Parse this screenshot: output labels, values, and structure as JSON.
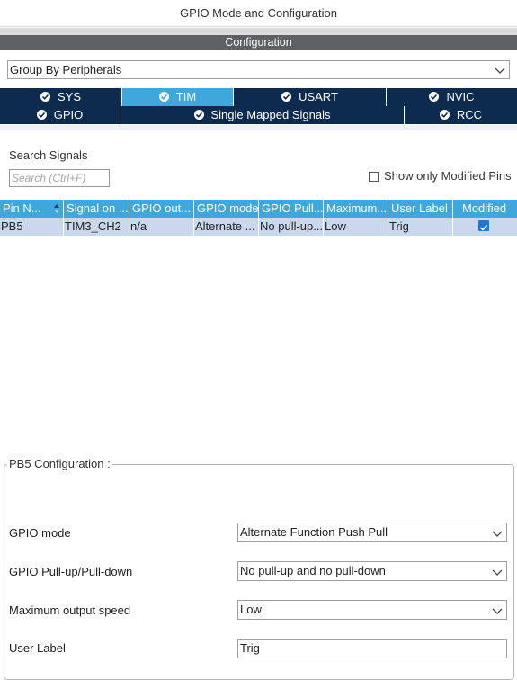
{
  "window": {
    "title": "GPIO Mode and Configuration"
  },
  "configuration_header": "Configuration",
  "group_select": {
    "value": "Group By Peripherals"
  },
  "tabs_row1": [
    {
      "label": "SYS",
      "active": false
    },
    {
      "label": "TIM",
      "active": true
    },
    {
      "label": "USART",
      "active": false
    },
    {
      "label": "NVIC",
      "active": false
    }
  ],
  "tabs_row2": [
    {
      "label": "GPIO"
    },
    {
      "label": "Single Mapped Signals"
    },
    {
      "label": "RCC"
    }
  ],
  "search": {
    "label": "Search Signals",
    "placeholder": "Search (Ctrl+F)"
  },
  "show_modified": {
    "label": "Show only Modified Pins",
    "checked": false
  },
  "table": {
    "columns": [
      "Pin N...",
      "Signal on ...",
      "GPIO out...",
      "GPIO mode",
      "GPIO Pull...",
      "Maximum...",
      "User Label",
      "Modified"
    ],
    "rows": [
      {
        "pin": "PB5",
        "signal": "TIM3_CH2",
        "gpio_out": "n/a",
        "gpio_mode": "Alternate ...",
        "gpio_pull": "No pull-up...",
        "max_speed": "Low",
        "user_label": "Trig",
        "modified": true
      }
    ]
  },
  "pin_config": {
    "title": "PB5 Configuration :",
    "fields": {
      "gpio_mode": {
        "label": "GPIO mode",
        "value": "Alternate Function Push Pull"
      },
      "pull": {
        "label": "GPIO Pull-up/Pull-down",
        "value": "No pull-up and no pull-down"
      },
      "speed": {
        "label": "Maximum output speed",
        "value": "Low"
      },
      "user_label": {
        "label": "User Label",
        "value": "Trig"
      }
    }
  },
  "colors": {
    "tab_dark": "#0d2a4f",
    "accent": "#3ea7dc",
    "row_selected": "#c9d8ec",
    "header_bar": "#5d6166"
  }
}
